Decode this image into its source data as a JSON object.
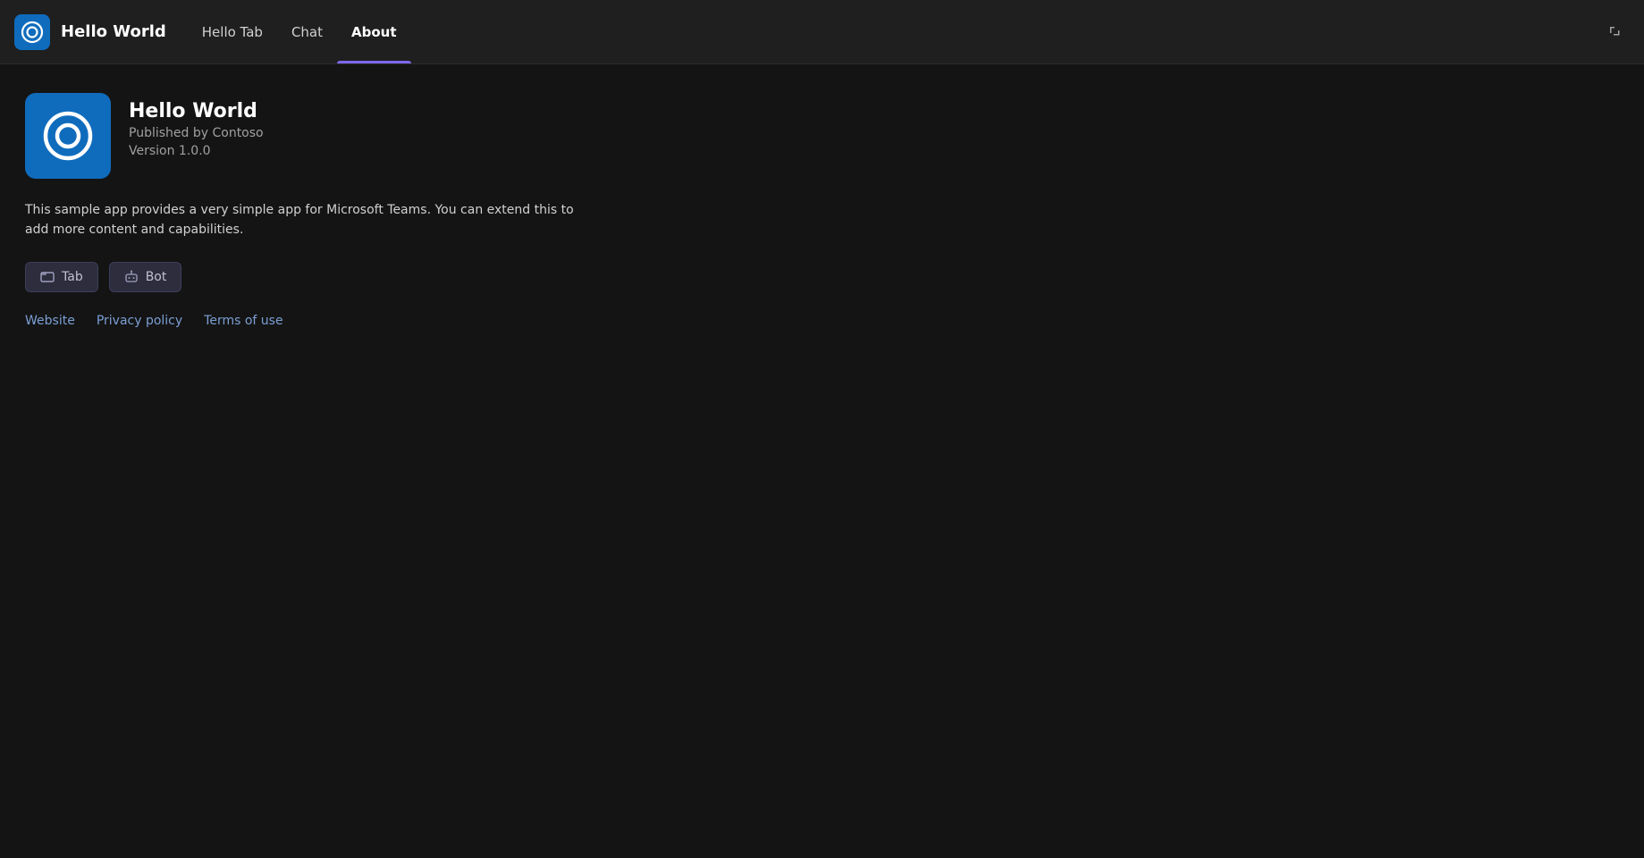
{
  "header": {
    "app_name": "Hello World",
    "tabs": [
      {
        "id": "hello-tab",
        "label": "Hello Tab",
        "active": false
      },
      {
        "id": "chat",
        "label": "Chat",
        "active": false
      },
      {
        "id": "about",
        "label": "About",
        "active": true
      }
    ],
    "expand_icon": "expand-icon"
  },
  "main": {
    "app_title": "Hello World",
    "app_publisher": "Published by Contoso",
    "app_version": "Version 1.0.0",
    "app_description": "This sample app provides a very simple app for Microsoft Teams. You can extend this to add more content and capabilities.",
    "capabilities": [
      {
        "id": "tab",
        "label": "Tab",
        "icon": "tab-icon"
      },
      {
        "id": "bot",
        "label": "Bot",
        "icon": "bot-icon"
      }
    ],
    "links": [
      {
        "id": "website",
        "label": "Website"
      },
      {
        "id": "privacy-policy",
        "label": "Privacy policy"
      },
      {
        "id": "terms-of-use",
        "label": "Terms of use"
      }
    ]
  }
}
